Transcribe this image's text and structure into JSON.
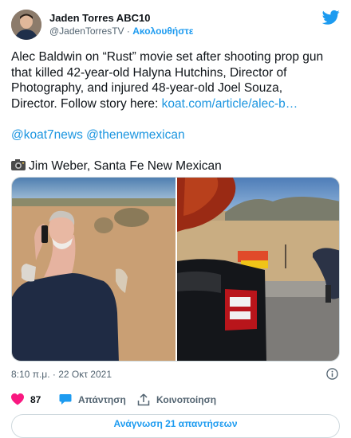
{
  "author": {
    "name": "Jaden Torres ABC10",
    "handle": "@JadenTorresTV",
    "separator": "·",
    "follow_label": "Ακολουθήστε"
  },
  "tweet": {
    "line1": "Alec Baldwin on “Rust” movie set after shooting prop gun",
    "line2": "that killed 42-year-old Halyna Hutchins, Director of",
    "line3": "Photography, and injured 48-year-old Joel Souza,",
    "line4_prefix": "Director. Follow story here: ",
    "link_text": "koat.com/article/alec-b…",
    "mention1": "@koat7news",
    "mention2": "@thenewmexican",
    "photo_credit": "Jim Weber, Santa Fe New Mexican"
  },
  "timestamp": "8:10 π.μ. · 22 Οκτ 2021",
  "actions": {
    "like_count": "87",
    "reply_label": "Απάντηση",
    "share_label": "Κοινοποίηση"
  },
  "read_replies_label": "Ανάγνωση 21 απαντήσεων",
  "colors": {
    "accent": "#1d9bf0",
    "like": "#f91880",
    "muted": "#536471"
  },
  "icons": [
    "twitter-bird-icon",
    "camera-icon",
    "heart-icon",
    "reply-bubble-icon",
    "share-icon",
    "info-icon"
  ]
}
